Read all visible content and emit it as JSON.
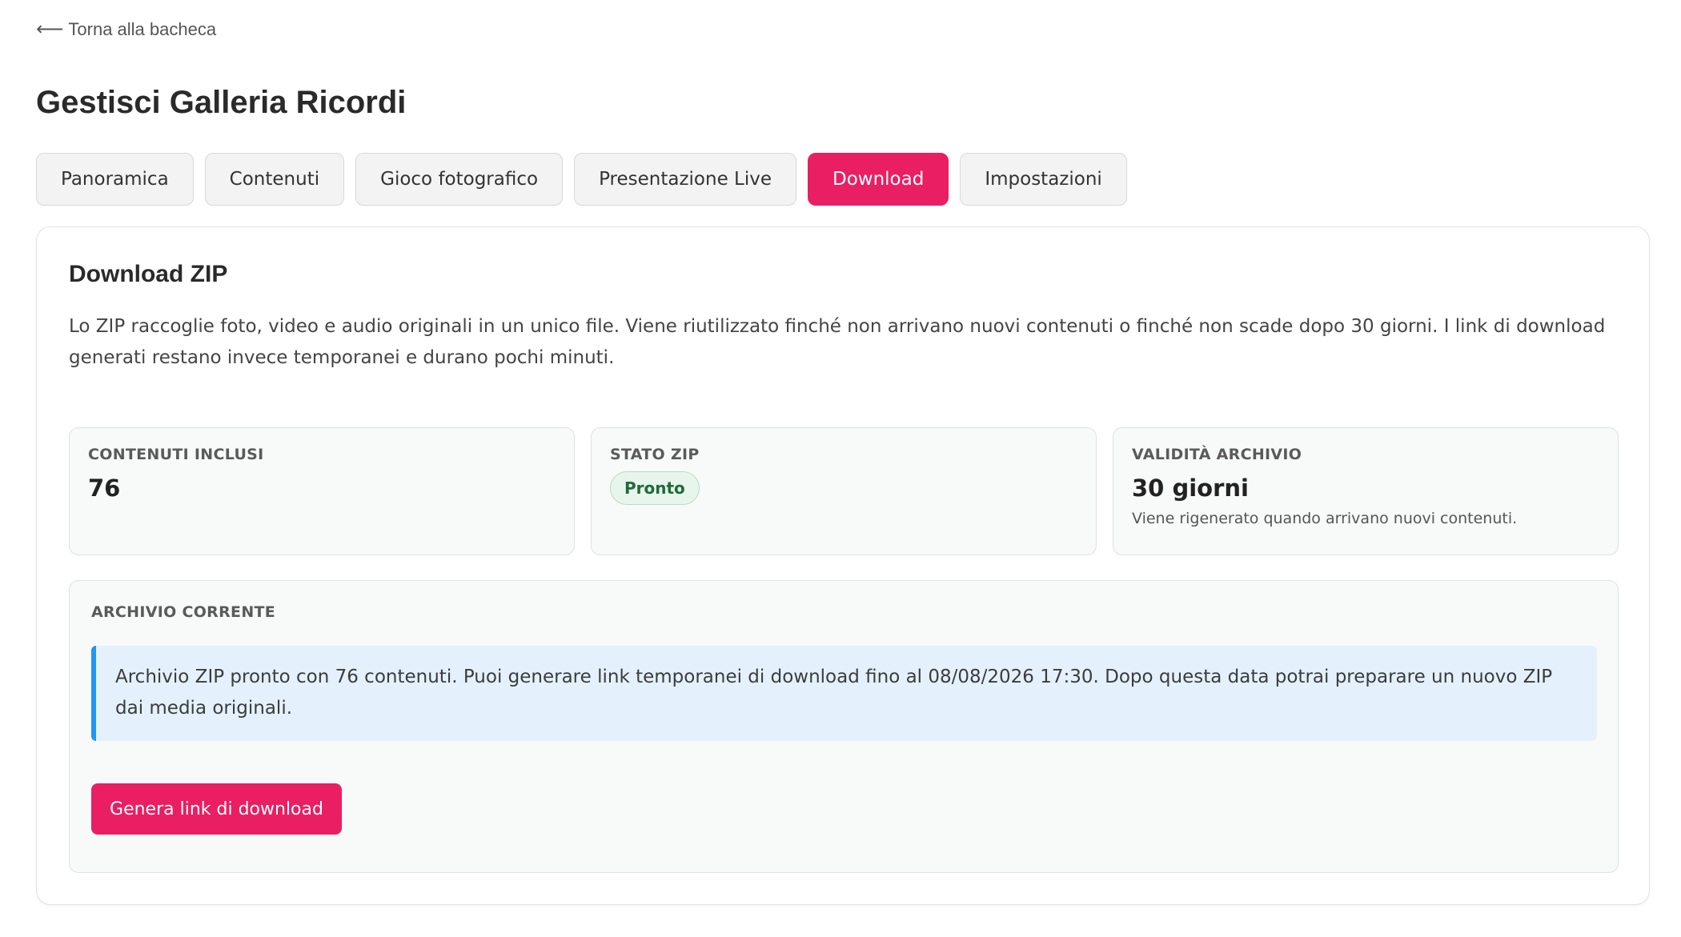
{
  "nav": {
    "back_label": "Torna alla bacheca",
    "back_icon": "arrow-left-icon"
  },
  "page": {
    "title": "Gestisci Galleria Ricordi"
  },
  "tabs": [
    {
      "label": "Panoramica",
      "active": false
    },
    {
      "label": "Contenuti",
      "active": false
    },
    {
      "label": "Gioco fotografico",
      "active": false
    },
    {
      "label": "Presentazione Live",
      "active": false
    },
    {
      "label": "Download",
      "active": true
    },
    {
      "label": "Impostazioni",
      "active": false
    }
  ],
  "download": {
    "title": "Download ZIP",
    "description": "Lo ZIP raccoglie foto, video e audio originali in un unico file. Viene riutilizzato finché non arrivano nuovi contenuti o finché non scade dopo 30 giorni. I link di download generati restano invece temporanei e durano pochi minuti.",
    "stats": {
      "contents": {
        "label": "CONTENUTI INCLUSI",
        "value": "76"
      },
      "status": {
        "label": "STATO ZIP",
        "badge": "Pronto"
      },
      "validity": {
        "label": "VALIDITÀ ARCHIVIO",
        "value": "30 giorni",
        "note": "Viene rigenerato quando arrivano nuovi contenuti."
      }
    },
    "archive": {
      "label": "ARCHIVIO CORRENTE",
      "info": "Archivio ZIP pronto con 76 contenuti. Puoi generare link temporanei di download fino al 08/08/2026 17:30. Dopo questa data potrai preparare un nuovo ZIP dai media originali.",
      "button_label": "Genera link di download"
    }
  },
  "colors": {
    "accent": "#e91e63",
    "info_border": "#2196f3",
    "info_bg": "#e4f1fc",
    "success_text": "#1f6b39"
  }
}
